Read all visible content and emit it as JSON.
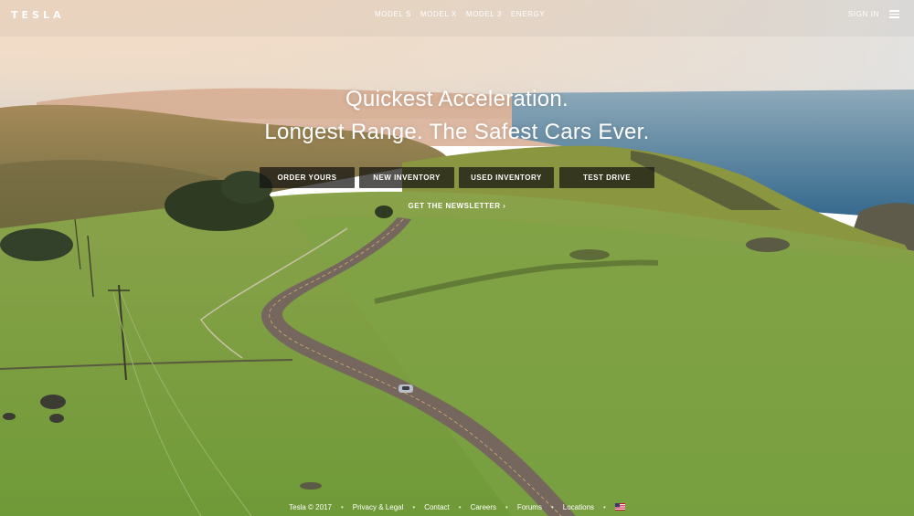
{
  "nav": {
    "logo": "TESLA",
    "links": [
      "MODEL S",
      "MODEL X",
      "MODEL 3",
      "ENERGY"
    ],
    "signin": "SIGN IN",
    "menu_icon": "hamburger-menu-icon"
  },
  "hero": {
    "line1": "Quickest Acceleration.",
    "line2": "Longest Range. The Safest Cars Ever.",
    "buttons": [
      "ORDER YOURS",
      "NEW INVENTORY",
      "USED INVENTORY",
      "TEST DRIVE"
    ],
    "newsletter": "GET THE NEWSLETTER ›"
  },
  "footer": {
    "copyright": "Tesla © 2017",
    "links": [
      "Privacy & Legal",
      "Contact",
      "Careers",
      "Forums",
      "Locations"
    ],
    "separator": "•",
    "region_icon": "us-flag-icon"
  },
  "colors": {
    "text": "#ffffff",
    "button_bg": "#141210",
    "grass": "#7ea446",
    "ocean": "#3f6f8f",
    "sky": "#f3ddc7"
  }
}
